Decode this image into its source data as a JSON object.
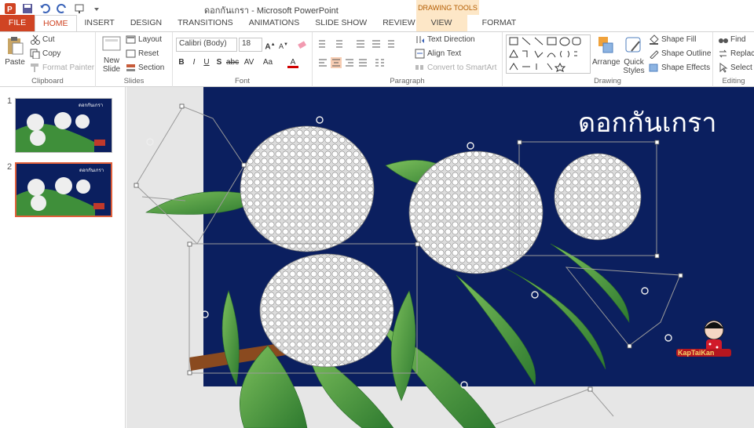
{
  "window": {
    "title": "ดอกกันเกรา - Microsoft PowerPoint"
  },
  "contextual": {
    "label": "DRAWING TOOLS"
  },
  "tabs": [
    "FILE",
    "HOME",
    "INSERT",
    "DESIGN",
    "TRANSITIONS",
    "ANIMATIONS",
    "SLIDE SHOW",
    "REVIEW",
    "VIEW",
    "FORMAT"
  ],
  "clipboard": {
    "label": "Clipboard",
    "paste": "Paste",
    "cut": "Cut",
    "copy": "Copy",
    "format_painter": "Format Painter"
  },
  "slides_group": {
    "label": "Slides",
    "new_slide_1": "New",
    "new_slide_2": "Slide",
    "layout": "Layout",
    "reset": "Reset",
    "section": "Section"
  },
  "font_group": {
    "label": "Font",
    "font_name": "Calibri (Body)",
    "font_size": "18"
  },
  "paragraph_group": {
    "label": "Paragraph",
    "text_direction": "Text Direction",
    "align_text": "Align Text",
    "convert_smartart": "Convert to SmartArt"
  },
  "drawing_group": {
    "label": "Drawing",
    "arrange": "Arrange",
    "quick_styles_1": "Quick",
    "quick_styles_2": "Styles",
    "shape_fill": "Shape Fill",
    "shape_outline": "Shape Outline",
    "shape_effects": "Shape Effects"
  },
  "editing_group": {
    "label": "Editing",
    "find": "Find",
    "replace": "Replace",
    "select": "Select"
  },
  "slides": [
    {
      "number": "1"
    },
    {
      "number": "2"
    }
  ],
  "slide": {
    "title": "ดอกกันเกรา",
    "logo_text": "KapTaiKan",
    "background": "#0b1f5f"
  },
  "colors": {
    "accent": "#d04423",
    "slide_bg": "#0b1f5f",
    "leaf": "#3f8f3a",
    "selection": "#e0603b"
  }
}
